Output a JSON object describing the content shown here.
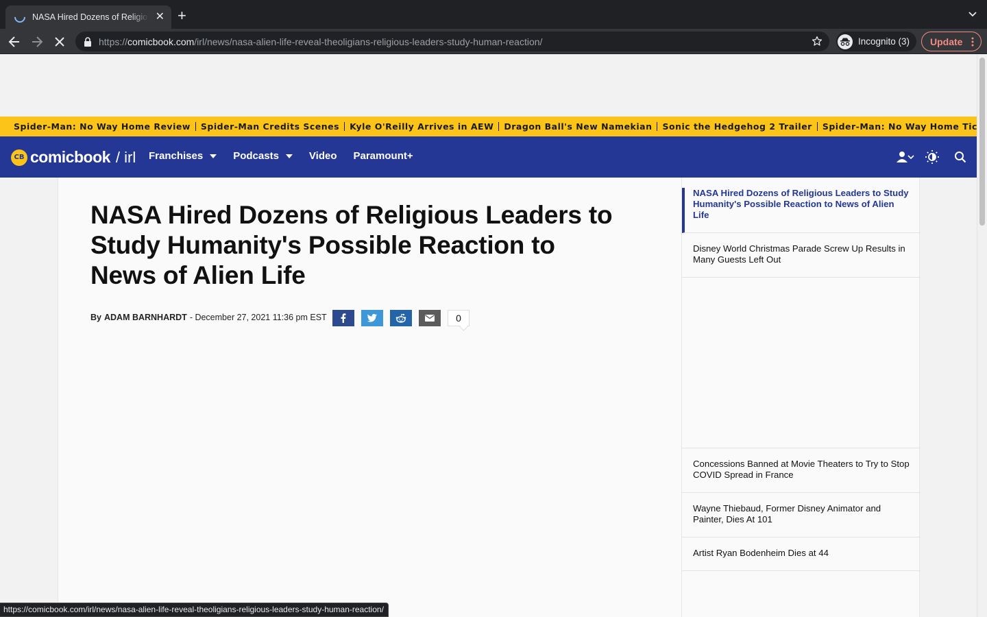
{
  "browser": {
    "tab_title": "NASA Hired Dozens of Religious Leaders to Study Humanity's Possible Reaction to News of Alien Life",
    "url_scheme": "https://",
    "url_host": "comicbook.com",
    "url_path": "/irl/news/nasa-alien-life-reveal-theoligians-religious-leaders-study-human-reaction/",
    "incognito_label": "Incognito (3)",
    "update_label": "Update",
    "status_url": "https://comicbook.com/irl/news/nasa-alien-life-reveal-theoligians-religious-leaders-study-human-reaction/"
  },
  "trending": [
    "Spider-Man: No Way Home Review",
    "Spider-Man Credits Scenes",
    "Kyle O'Reilly Arrives in AEW",
    "Dragon Ball's New Namekian",
    "Sonic the Hedgehog 2 Trailer",
    "Spider-Man: No Way Home Tickets On S"
  ],
  "site": {
    "logo_badge": "CB",
    "logo_word": "comicbook",
    "logo_section": "/ irl",
    "menu": {
      "franchises": "Franchises",
      "podcasts": "Podcasts",
      "video": "Video",
      "paramount": "Paramount+"
    }
  },
  "article": {
    "headline": "NASA Hired Dozens of Religious Leaders to Study Humanity's Possible Reaction to News of Alien Life",
    "by": "By",
    "author": "ADAM BARNHARDT",
    "date": "- December 27, 2021 11:36 pm EST",
    "comment_count": "0"
  },
  "sidebar": {
    "items": [
      "NASA Hired Dozens of Religious Leaders to Study Humanity's Possible Reaction to News of Alien Life",
      "Disney World Christmas Parade Screw Up Results in Many Guests Left Out",
      "Concessions Banned at Movie Theaters to Try to Stop COVID Spread in France",
      "Wayne Thiebaud, Former Disney Animator and Painter, Dies At 101",
      "Artist Ryan Bodenheim Dies at 44"
    ]
  },
  "colors": {
    "nav_blue": "#243795",
    "trending_yellow": "#fcc419",
    "facebook": "#2d4a8f",
    "twitter": "#3e97d8",
    "reddit": "#2365a8",
    "email": "#5b5b5b"
  }
}
